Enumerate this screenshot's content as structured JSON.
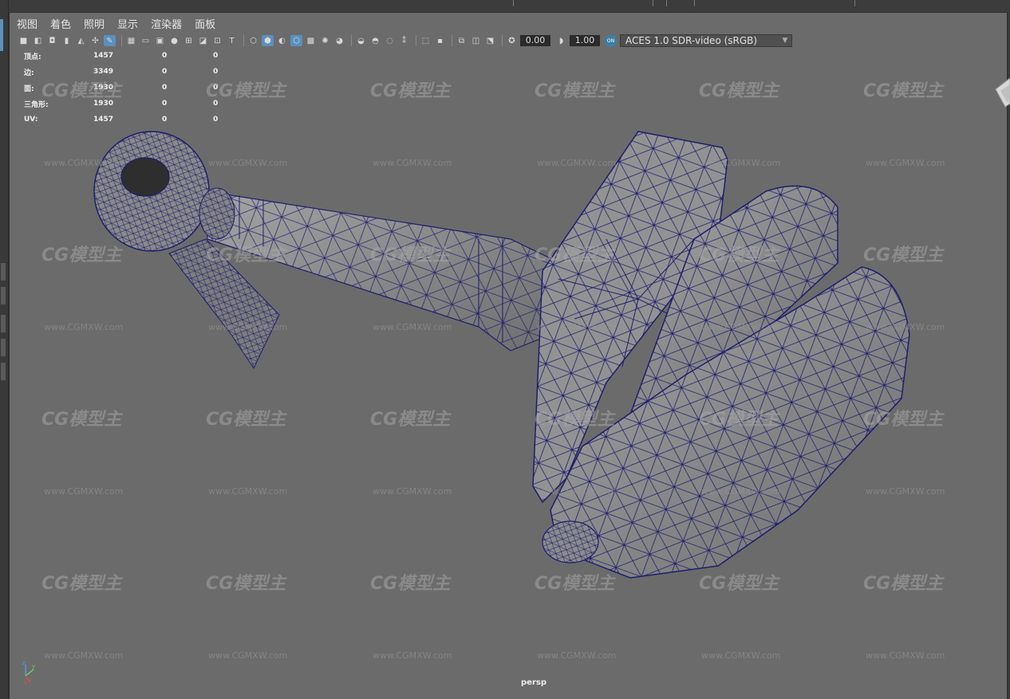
{
  "menu": [
    "视图",
    "着色",
    "照明",
    "显示",
    "渲染器",
    "面板"
  ],
  "toolbar": {
    "icons": [
      "camera-icon",
      "camera-attr-icon",
      "bookmark-icon",
      "bookmark2-icon",
      "image-plane-icon",
      "pivot-icon",
      "grease-pencil-icon",
      "grid-icon",
      "film-gate-icon",
      "resolution-gate-icon",
      "gate-mask-icon",
      "field-chart-icon",
      "safe-action-icon",
      "safe-title-icon",
      "wireframe-icon",
      "smooth-shade-icon",
      "default-material-icon",
      "wireframe-on-shaded-icon",
      "textured-icon",
      "use-all-lights-icon",
      "shadows-icon",
      "screen-space-ao-icon",
      "motion-blur-icon",
      "multisample-aa-icon",
      "depth-of-field-icon",
      "isolate-select-icon",
      "xray-icon",
      "xray-active-icon",
      "backface-icon",
      "exposure-icon",
      "gamma-icon",
      "color-management-icon"
    ],
    "exposure": "0.00",
    "gamma": "1.00",
    "color_management_badge": "ON",
    "view_transform": "ACES 1.0 SDR-video (sRGB)"
  },
  "hud": {
    "rows": [
      {
        "label": "顶点:",
        "v1": "1457",
        "v2": "0",
        "v3": "0"
      },
      {
        "label": "边:",
        "v1": "3349",
        "v2": "0",
        "v3": "0"
      },
      {
        "label": "面:",
        "v1": "1930",
        "v2": "0",
        "v3": "0"
      },
      {
        "label": "三角形:",
        "v1": "1930",
        "v2": "0",
        "v3": "0"
      },
      {
        "label": "UV:",
        "v1": "1457",
        "v2": "0",
        "v3": "0"
      }
    ]
  },
  "camera_label": "persp",
  "watermark": {
    "logo": "CG模型主",
    "url": "www.CGMXW.com"
  },
  "colors": {
    "viewport_bg": "#6b6b6b",
    "wire": "#1e1e6e",
    "mesh_fill": "#8e8e8e",
    "accent": "#5a8fbf"
  }
}
